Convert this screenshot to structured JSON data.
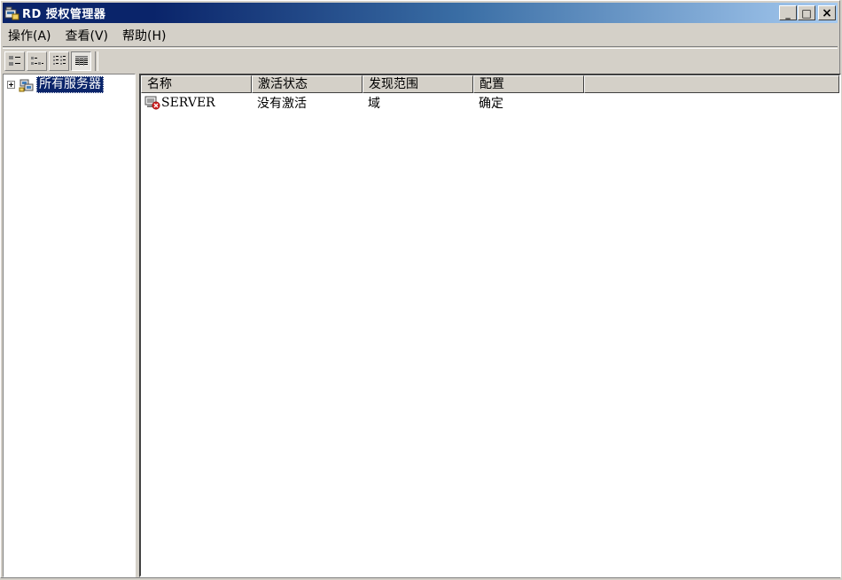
{
  "window": {
    "title": "RD 授权管理器",
    "minimize_glyph": "_",
    "maximize_glyph": "□",
    "close_glyph": "×"
  },
  "menu": {
    "items": [
      {
        "label": "操作(A)"
      },
      {
        "label": "查看(V)"
      },
      {
        "label": "帮助(H)"
      }
    ]
  },
  "toolbar": {
    "buttons": [
      {
        "icon": "large-icons-view-icon",
        "pressed": false
      },
      {
        "icon": "small-icons-view-icon",
        "pressed": false
      },
      {
        "icon": "list-view-icon",
        "pressed": false
      },
      {
        "icon": "detail-view-icon",
        "pressed": true
      }
    ]
  },
  "tree": {
    "root": {
      "label": "所有服务器",
      "icon": "server-group-icon",
      "selected": true
    }
  },
  "list": {
    "columns": [
      "名称",
      "激活状态",
      "发现范围",
      "配置"
    ],
    "rows": [
      {
        "name": "SERVER",
        "activation": "没有激活",
        "scope": "域",
        "config": "确定",
        "icon": "server-error-icon"
      }
    ]
  },
  "colors": {
    "title_start": "#0a246a",
    "title_end": "#a6caf0",
    "selection": "#0a246a",
    "face": "#d4d0c8"
  }
}
